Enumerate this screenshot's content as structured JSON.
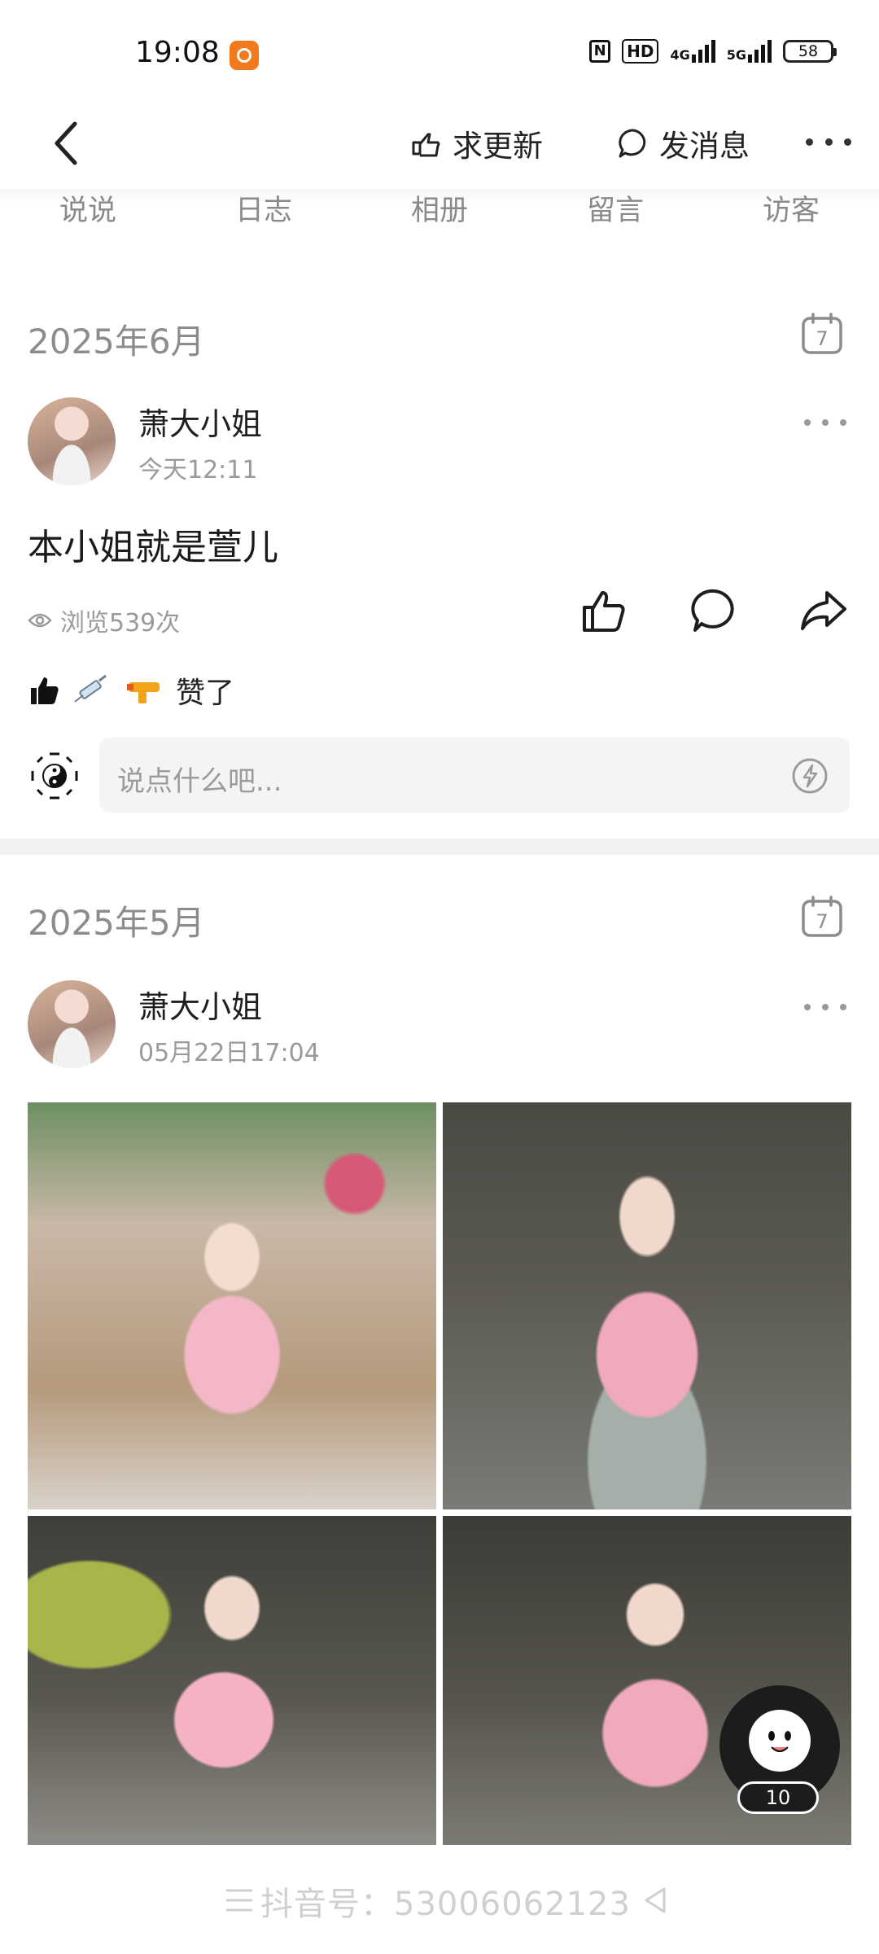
{
  "status_bar": {
    "time": "19:08",
    "hd_label": "HD",
    "net_4g": "4G",
    "net_5g": "5G",
    "battery": "58"
  },
  "header": {
    "request_update": "求更新",
    "send_message": "发消息"
  },
  "tabs": [
    "说说",
    "日志",
    "相册",
    "留言",
    "访客"
  ],
  "calendar_day": "7",
  "posts": [
    {
      "month": "2025年6月",
      "author": "萧大小姐",
      "time": "今天12:11",
      "text": "本小姐就是萱儿",
      "views": "浏览539次",
      "liked_by": "赞了"
    },
    {
      "month": "2025年5月",
      "author": "萧大小姐",
      "time": "05月22日17:04"
    }
  ],
  "comment": {
    "placeholder": "说点什么吧..."
  },
  "floating": {
    "count": "10"
  },
  "navbar": {
    "watermark": "抖音号：53006062123"
  }
}
